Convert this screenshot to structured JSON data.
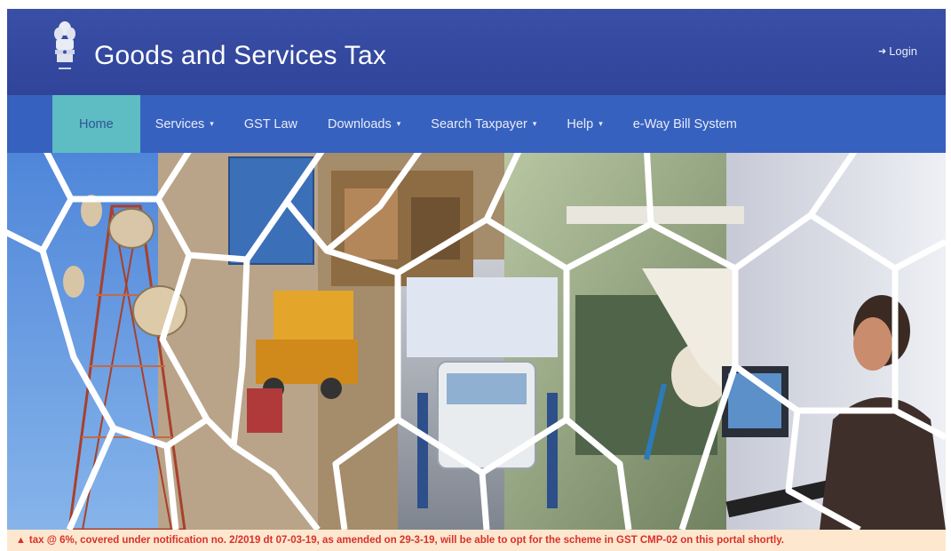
{
  "header": {
    "title": "Goods and Services Tax",
    "login_label": "Login",
    "login_icon": "sign-in-icon",
    "emblem": "national-emblem-logo"
  },
  "nav": {
    "items": [
      {
        "label": "Home",
        "active": true,
        "dropdown": false
      },
      {
        "label": "Services",
        "active": false,
        "dropdown": true
      },
      {
        "label": "GST Law",
        "active": false,
        "dropdown": false
      },
      {
        "label": "Downloads",
        "active": false,
        "dropdown": true
      },
      {
        "label": "Search Taxpayer",
        "active": false,
        "dropdown": true
      },
      {
        "label": "Help",
        "active": false,
        "dropdown": true
      },
      {
        "label": "e-Way Bill System",
        "active": false,
        "dropdown": false
      }
    ]
  },
  "banner": {
    "image": "hexagon-collage-industry"
  },
  "ticker": {
    "text": "tax @ 6%, covered under notification no. 2/2019 dt 07-03-19, as amended on 29-3-19, will be able to opt for the scheme in GST CMP-02 on this portal shortly.",
    "icon": "alert-icon"
  },
  "colors": {
    "header_bg": "#3a4fa6",
    "nav_bg": "#3761bf",
    "nav_active_bg": "#5dbdc3",
    "ticker_bg": "#fde8cf",
    "ticker_text": "#d9302a"
  }
}
